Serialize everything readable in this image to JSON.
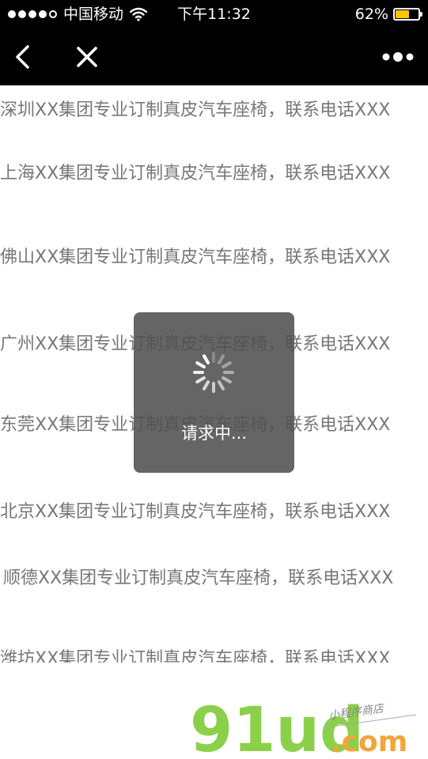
{
  "status_bar": {
    "carrier": "中国移动",
    "time": "下午11:32",
    "battery_percent": "62%",
    "battery_level": 0.62,
    "signal_bars_filled": 4,
    "signal_bars_total": 5
  },
  "nav": {
    "back_icon": "chevron-left-icon",
    "close_icon": "close-icon",
    "more_icon": "more-dots-icon"
  },
  "list": [
    "深圳XX集团专业订制真皮汽车座椅，联系电话XXX",
    "上海XX集团专业订制真皮汽车座椅，联系电话XXX",
    "佛山XX集团专业订制真皮汽车座椅，联系电话XXX",
    "广州XX集团专业订制真皮汽车座椅，联系电话XXX",
    "东莞XX集团专业订制真皮汽车座椅，联系电话XXX",
    "北京XX集团专业订制真皮汽车座椅，联系电话XXX",
    "顺德XX集团专业订制真皮汽车座椅，联系电话XXX",
    "潍坊XX集团专业订制真皮汽车座椅，联系电话XXX"
  ],
  "loading": {
    "label": "请求中..."
  },
  "watermark": {
    "logo": "91ud",
    "domain": ".com",
    "tagline": "小程序商店"
  },
  "colors": {
    "topbar": "#000000",
    "text": "#777777",
    "toast_bg": "#505050",
    "battery": "#f7c600",
    "logo_green": "#8bd04a",
    "logo_orange": "#f2a53a"
  }
}
